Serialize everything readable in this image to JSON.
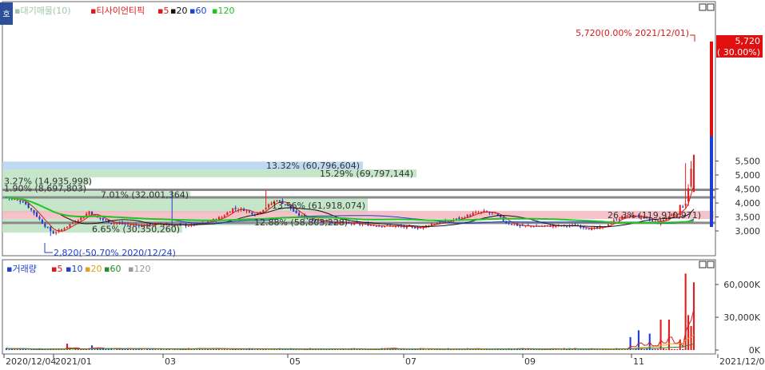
{
  "panel_badge": "호",
  "price_legend": [
    {
      "text": "▪대기매물(10)",
      "color": "#9fc9a4"
    },
    {
      "text": "▪티사이언티픽",
      "color": "#d81b1b"
    },
    {
      "text": "▪5",
      "color": "#d81b1b"
    },
    {
      "text": "▪20",
      "color": "#111111"
    },
    {
      "text": "▪60",
      "color": "#1e3fd0"
    },
    {
      "text": "▪120",
      "color": "#22c422"
    }
  ],
  "volume_legend": [
    {
      "text": "▪거래량",
      "color": "#1e3fd0"
    },
    {
      "text": "▪5",
      "color": "#d81b1b"
    },
    {
      "text": "▪10",
      "color": "#1e3fd0"
    },
    {
      "text": "▪20",
      "color": "#e0a020"
    },
    {
      "text": "▪60",
      "color": "#2a8a2a"
    },
    {
      "text": "▪120",
      "color": "#999999"
    }
  ],
  "price_axis_ticks": [
    "5,500",
    "5,000",
    "4,500",
    "4,000",
    "3,500",
    "3,000"
  ],
  "volume_axis_ticks": [
    "60,000K",
    "30,000K",
    "0K"
  ],
  "date_axis_ticks": [
    "2020/12/04",
    "2021/01",
    "03",
    "05",
    "07",
    "09",
    "11",
    "2021/12/08"
  ],
  "last_price_tag": {
    "price": "5,720",
    "change": "( 30.00%)"
  },
  "annotations": {
    "high": "5,720(0.00% 2021/12/01)",
    "low": "2,820(-50.70% 2020/12/24)"
  },
  "colors": {
    "up": "#e02020",
    "down": "#1e3fd0",
    "ma5": "#d81b1b",
    "ma20": "#111111",
    "ma60": "#1e3fd0",
    "ma120": "#22c422",
    "supply_blue": "#b8d6ee",
    "supply_green": "#bfe3c3",
    "supply_pink": "#f2b8c0"
  },
  "chart_data": {
    "type": "candlestick-with-volume",
    "security": "티사이언티픽",
    "period": [
      "2020/12/04",
      "2021/12/08"
    ],
    "last_close": 5720,
    "last_change_pct": 30.0,
    "high": {
      "price": 5720,
      "pct_from_last": 0.0,
      "date": "2021/12/01"
    },
    "low": {
      "price": 2820,
      "pct_from_last": -50.7,
      "date": "2020/12/24"
    },
    "price_axis": {
      "min": 3000,
      "max": 5500,
      "step": 500
    },
    "volume_axis": {
      "min": 0,
      "max": 60000,
      "unit": "K",
      "step": 30000
    },
    "moving_averages": [
      "5",
      "20",
      "60",
      "120"
    ],
    "supply_zones": [
      {
        "label": "13.32% (60,796,604)",
        "price_low": 5200,
        "price_high": 5480,
        "color": "blue"
      },
      {
        "label": "15.29% (69,797,144)",
        "price_low": 4920,
        "price_high": 5200,
        "color": "green"
      },
      {
        "label": "3.27% (14,935,998)",
        "price_low": 4650,
        "price_high": 4920,
        "color": "green"
      },
      {
        "label": "1.90% (8,697,803)",
        "price_low": 4420,
        "price_high": 4650,
        "color": "green"
      },
      {
        "label": "7.01% (32,001,364)",
        "price_low": 4180,
        "price_high": 4420,
        "color": "green"
      },
      {
        "label": "13.56% (61,918,074)",
        "price_low": 3650,
        "price_high": 4180,
        "color": "green"
      },
      {
        "label": "26.3% (119,910,971)",
        "price_low": 3430,
        "price_high": 3720,
        "color": "pink"
      },
      {
        "label": "12.88% (58,803,228)",
        "price_low": 3200,
        "price_high": 3430,
        "color": "green"
      },
      {
        "label": "6.65% (30,350,260)",
        "price_low": 2940,
        "price_high": 3200,
        "color": "green"
      }
    ],
    "horizontal_lines": [
      4470,
      4200,
      3290
    ]
  }
}
